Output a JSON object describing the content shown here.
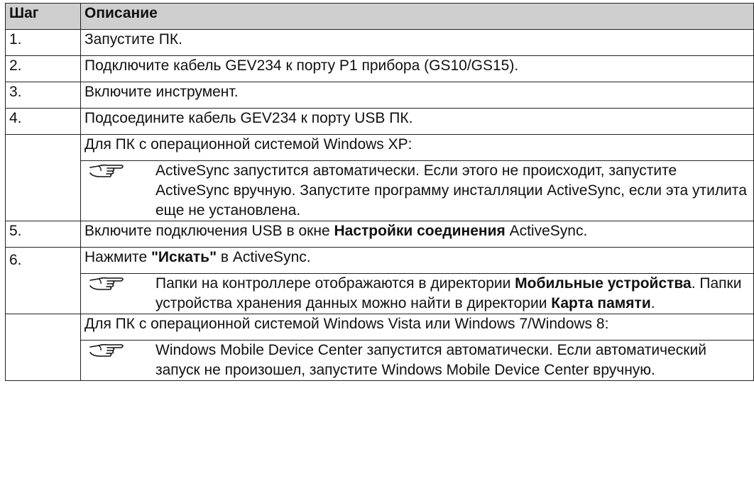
{
  "table": {
    "header": {
      "step": "Шаг",
      "description": "Описание"
    },
    "rows": [
      {
        "step": "1.",
        "text": "Запустите ПК."
      },
      {
        "step": "2.",
        "text": "Подключите кабель GEV234 к порту P1 прибора (GS10/GS15)."
      },
      {
        "step": "3.",
        "text": "Включите инструмент."
      },
      {
        "step": "4.",
        "text": "Подсоедините кабель GEV234 к порту USB ПК."
      },
      {
        "step": "",
        "text": "Для ПК с операционной системой Windows XP:"
      },
      {
        "note": "ActiveSync запустится автоматически. Если этого не происходит, запустите ActiveSync вручную. Запустите программу инсталляции ActiveSync, если эта утилита еще не установлена."
      },
      {
        "step": "5.",
        "text_before": "Включите подключения USB в окне ",
        "text_bold": "Настройки соединения",
        "text_after": " ActiveSync."
      },
      {
        "step": "6.",
        "text_before": "Нажмите ",
        "text_bold": "\"Искать\"",
        "text_after": " в ActiveSync."
      },
      {
        "note_p1": "Папки на контроллере отображаются в директории ",
        "note_b1": "Мобильные устройства",
        "note_p2": ". Папки устройства хранения данных можно найти в директории ",
        "note_b2": "Карта памяти",
        "note_p3": "."
      },
      {
        "step": "",
        "text": "Для ПК с операционной системой Windows Vista или Windows 7/Windows 8:"
      },
      {
        "note": "Windows Mobile Device Center запустится автоматически. Если автоматический запуск не произошел, запустите Windows Mobile Device Center вручную."
      }
    ],
    "icon": "pointing-hand-icon"
  }
}
